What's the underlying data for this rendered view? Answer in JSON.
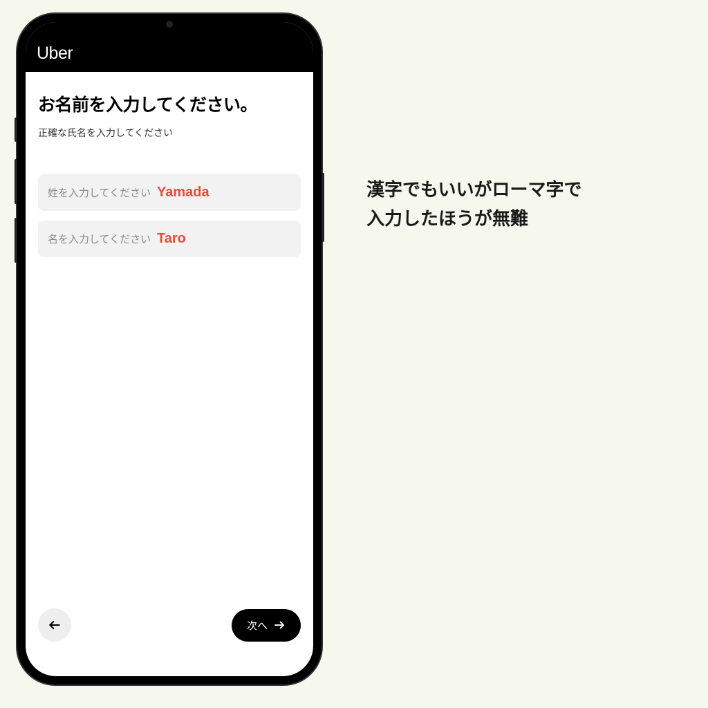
{
  "header": {
    "logo": "Uber"
  },
  "page": {
    "title": "お名前を入力してください。",
    "subtitle": "正確な氏名を入力してください"
  },
  "inputs": {
    "lastname": {
      "placeholder": "姓を入力してください",
      "value": "Yamada"
    },
    "firstname": {
      "placeholder": "名を入力してください",
      "value": "Taro"
    }
  },
  "footer": {
    "next_label": "次へ"
  },
  "annotation": {
    "text": "漢字でもいいがローマ字で\n入力したほうが無難"
  },
  "colors": {
    "accent_red": "#e74c3c",
    "background": "#f6f8ed"
  }
}
